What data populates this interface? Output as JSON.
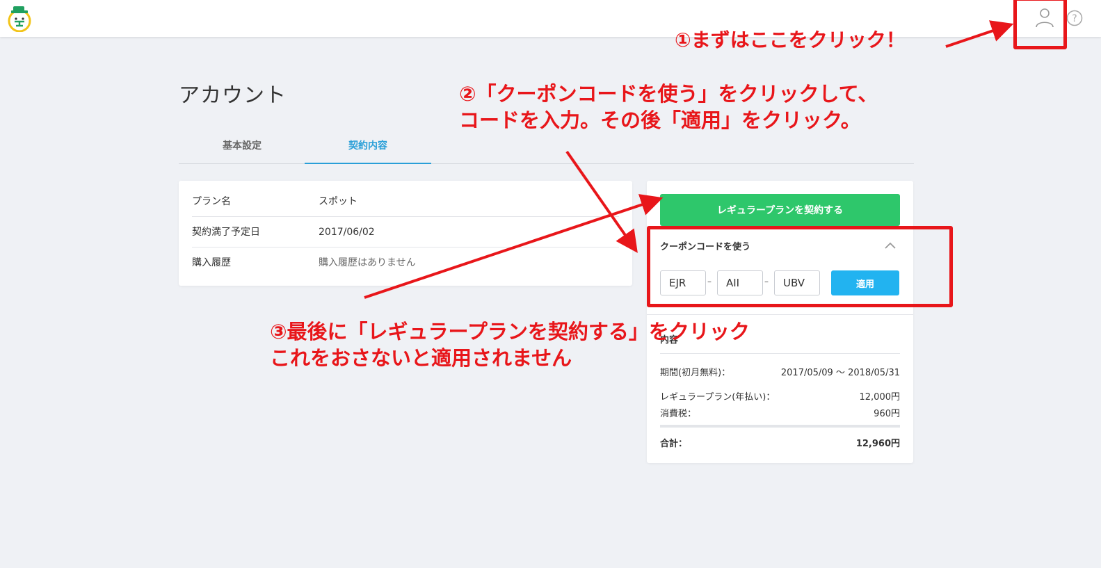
{
  "header": {
    "logo_icon": "mascot-logo-icon",
    "user_icon": "user-icon",
    "help_icon": "help-icon"
  },
  "page": {
    "title": "アカウント"
  },
  "tabs": [
    {
      "label": "基本設定",
      "active": false
    },
    {
      "label": "契約内容",
      "active": true
    }
  ],
  "info": {
    "rows": [
      {
        "label": "プラン名",
        "value": "スポット"
      },
      {
        "label": "契約満了予定日",
        "value": "2017/06/02"
      },
      {
        "label": "購入履歴",
        "value": "購入履歴はありません"
      }
    ]
  },
  "side": {
    "regular_button": "レギュラープランを契約する",
    "coupon_label": "クーポンコードを使う",
    "codes": [
      "EJR",
      "AII",
      "UBV"
    ],
    "dash": "–",
    "apply_button": "適用",
    "detail_heading": "内容",
    "period_label": "期間(初月無料)：",
    "period_value": "2017/05/09 〜 2018/05/31",
    "plan_label": "レギュラープラン(年払い)：",
    "plan_value": "12,000円",
    "tax_label": "消費税：",
    "tax_value": "960円",
    "total_label": "合計：",
    "total_value": "12,960円"
  },
  "annotations": {
    "color": "#e8161a",
    "step1": "①まずはここをクリック！",
    "step2_line1": "②「クーポンコードを使う」をクリックして、",
    "step2_line2": "コードを入力。その後「適用」をクリック。",
    "step3_line1": "③最後に「レギュラープランを契約する」をクリック",
    "step3_line2": "これをおさないと適用されません"
  },
  "colors": {
    "background": "#eff1f5",
    "active_tab": "#2a9fd8",
    "green_button": "#2ec76b",
    "apply_button": "#22b3f0"
  }
}
